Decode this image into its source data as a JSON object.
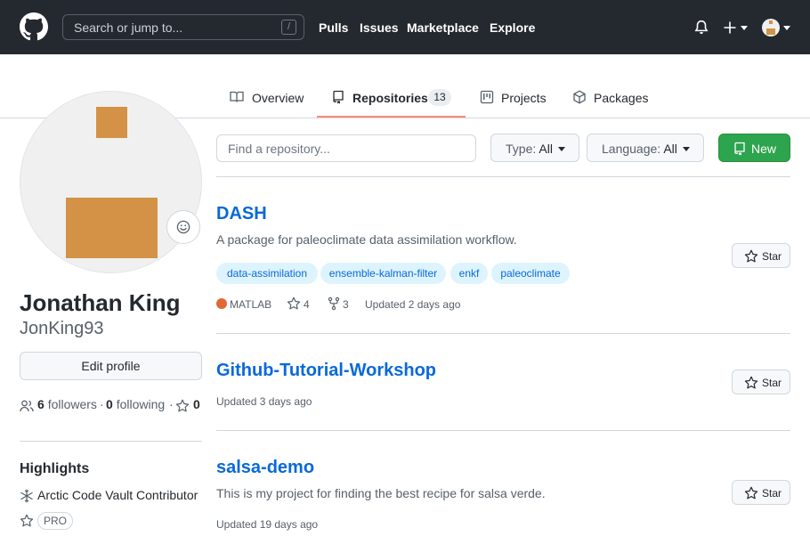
{
  "header": {
    "search_placeholder": "Search or jump to...",
    "search_shortcut": "/",
    "nav": [
      "Pulls",
      "Issues",
      "Marketplace",
      "Explore"
    ]
  },
  "tabs": [
    {
      "label": "Overview",
      "icon": "book-icon"
    },
    {
      "label": "Repositories",
      "icon": "repo-icon",
      "count": "13",
      "active": true
    },
    {
      "label": "Projects",
      "icon": "project-icon"
    },
    {
      "label": "Packages",
      "icon": "package-icon"
    }
  ],
  "profile": {
    "full_name": "Jonathan King",
    "username": "JonKing93",
    "edit_label": "Edit profile",
    "followers_count": "6",
    "followers_label": "followers",
    "separator": "·",
    "following_count": "0",
    "following_label": "following",
    "stars_count": "0",
    "highlights_title": "Highlights",
    "highlight_item": "Arctic Code Vault Contributor",
    "pro_badge": "PRO"
  },
  "filters": {
    "find_placeholder": "Find a repository...",
    "type_label": "Type:",
    "type_value": "All",
    "language_label": "Language:",
    "language_value": "All",
    "new_label": "New"
  },
  "repos": [
    {
      "name": "DASH",
      "description": "A package for paleoclimate data assimilation workflow.",
      "topics": [
        "data-assimilation",
        "ensemble-kalman-filter",
        "enkf",
        "paleoclimate"
      ],
      "language": "MATLAB",
      "language_color": "#e16737",
      "stars": "4",
      "forks": "3",
      "updated": "Updated 2 days ago",
      "star_label": "Star"
    },
    {
      "name": "Github-Tutorial-Workshop",
      "updated": "Updated 3 days ago",
      "star_label": "Star"
    },
    {
      "name": "salsa-demo",
      "description": "This is my project for finding the best recipe for salsa verde.",
      "updated": "Updated 19 days ago",
      "star_label": "Star"
    }
  ],
  "colors": {
    "header_bg": "#24292f",
    "link": "#0969da",
    "new_button": "#2da44e",
    "active_tab_underline": "#fd8c73",
    "avatar_accent": "#d39245"
  }
}
